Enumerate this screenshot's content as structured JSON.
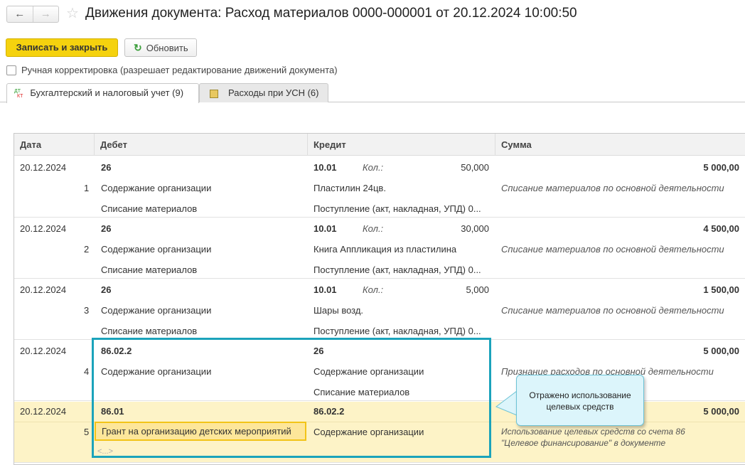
{
  "window": {
    "title": "Движения документа: Расход материалов 0000-000001 от 20.12.2024 10:00:50",
    "back": "←",
    "forward": "→",
    "star": "☆"
  },
  "toolbar": {
    "save_close": "Записать и закрыть",
    "refresh": "Обновить",
    "refresh_icon": "↻"
  },
  "manual": {
    "label": "Ручная корректировка (разрешает редактирование движений документа)",
    "checked": false
  },
  "tabs": [
    {
      "label": "Бухгалтерский и налоговый учет (9)",
      "icon_dt": "ДТ",
      "icon_kt": "КТ"
    },
    {
      "label": "Расходы при УСН (6)",
      "icon": "▤"
    }
  ],
  "columns": [
    "Дата",
    "Дебет",
    "Кредит",
    "Сумма"
  ],
  "qty_label": "Кол.:",
  "rows": [
    {
      "date": "20.12.2024",
      "n": "1",
      "debit": "26",
      "debit2": "Содержание организации",
      "debit3": "Списание материалов",
      "credit": "10.01",
      "qty": "50,000",
      "credit2": "Пластилин 24цв.",
      "credit3": "Поступление (акт, накладная, УПД) 0...",
      "sum": "5 000,00",
      "desc": "Списание материалов по основной деятельности"
    },
    {
      "date": "20.12.2024",
      "n": "2",
      "debit": "26",
      "debit2": "Содержание организации",
      "debit3": "Списание материалов",
      "credit": "10.01",
      "qty": "30,000",
      "credit2": "Книга Аппликация из пластилина",
      "credit3": "Поступление (акт, накладная, УПД) 0...",
      "sum": "4 500,00",
      "desc": "Списание материалов по основной деятельности"
    },
    {
      "date": "20.12.2024",
      "n": "3",
      "debit": "26",
      "debit2": "Содержание организации",
      "debit3": "Списание материалов",
      "credit": "10.01",
      "qty": "5,000",
      "credit2": "Шары возд.",
      "credit3": "Поступление (акт, накладная, УПД) 0...",
      "sum": "1 500,00",
      "desc": "Списание материалов по основной деятельности"
    },
    {
      "date": "20.12.2024",
      "n": "4",
      "debit": "86.02.2",
      "debit2": "Содержание организации",
      "credit": "26",
      "credit2": "Содержание организации",
      "credit3": "Списание материалов",
      "sum": "5 000,00",
      "desc": "Признание расходов по основной деятельности"
    },
    {
      "date": "20.12.2024",
      "n": "5",
      "debit": "86.01",
      "debit2": "Грант на организацию детских мероприятий",
      "debit3": "<...>",
      "credit": "86.02.2",
      "credit2": "Содержание организации",
      "sum": "5 000,00",
      "desc": "Использование целевых средств со счета 86",
      "desc2": "\"Целевое финансирование\" в документе"
    }
  ],
  "callout": "Отражено использование целевых средств",
  "colors": {
    "accent": "#f5d20e",
    "highlight": "#1ba3bb",
    "selected_row": "#fdf3c7"
  }
}
